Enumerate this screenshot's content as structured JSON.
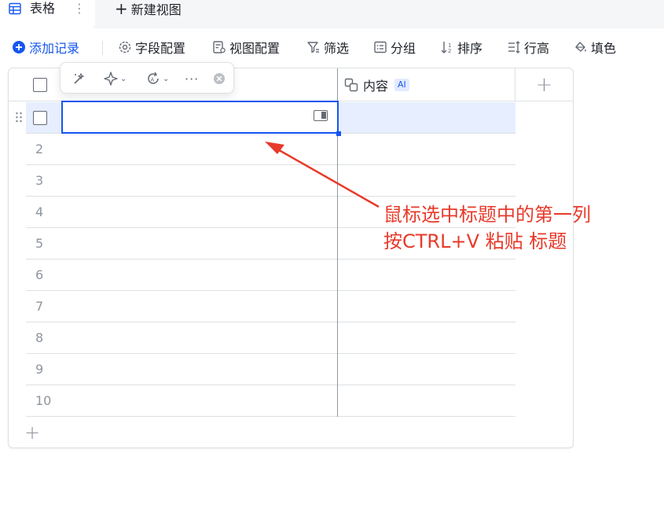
{
  "tabs": {
    "active_label": "表格",
    "more_label": "⋮",
    "new_view_label": "新建视图"
  },
  "toolbar": {
    "add_record": "添加记录",
    "field_config": "字段配置",
    "view_config": "视图配置",
    "filter": "筛选",
    "group": "分组",
    "sort": "排序",
    "row_height": "行高",
    "fill_color": "填色"
  },
  "grid": {
    "column2_header": "内容",
    "ai_badge": "AI",
    "add_column": "+",
    "add_row": "+",
    "row_numbers": [
      "2",
      "3",
      "4",
      "5",
      "6",
      "7",
      "8",
      "9",
      "10"
    ]
  },
  "floatbar": {
    "more": "···"
  },
  "annotation": {
    "line1": "鼠标选中标题中的第一列",
    "line2": "按CTRL+V 粘贴 标题",
    "color": "#e83a2a"
  },
  "colors": {
    "accent": "#1456f0",
    "selected_row": "#e6eeff"
  }
}
